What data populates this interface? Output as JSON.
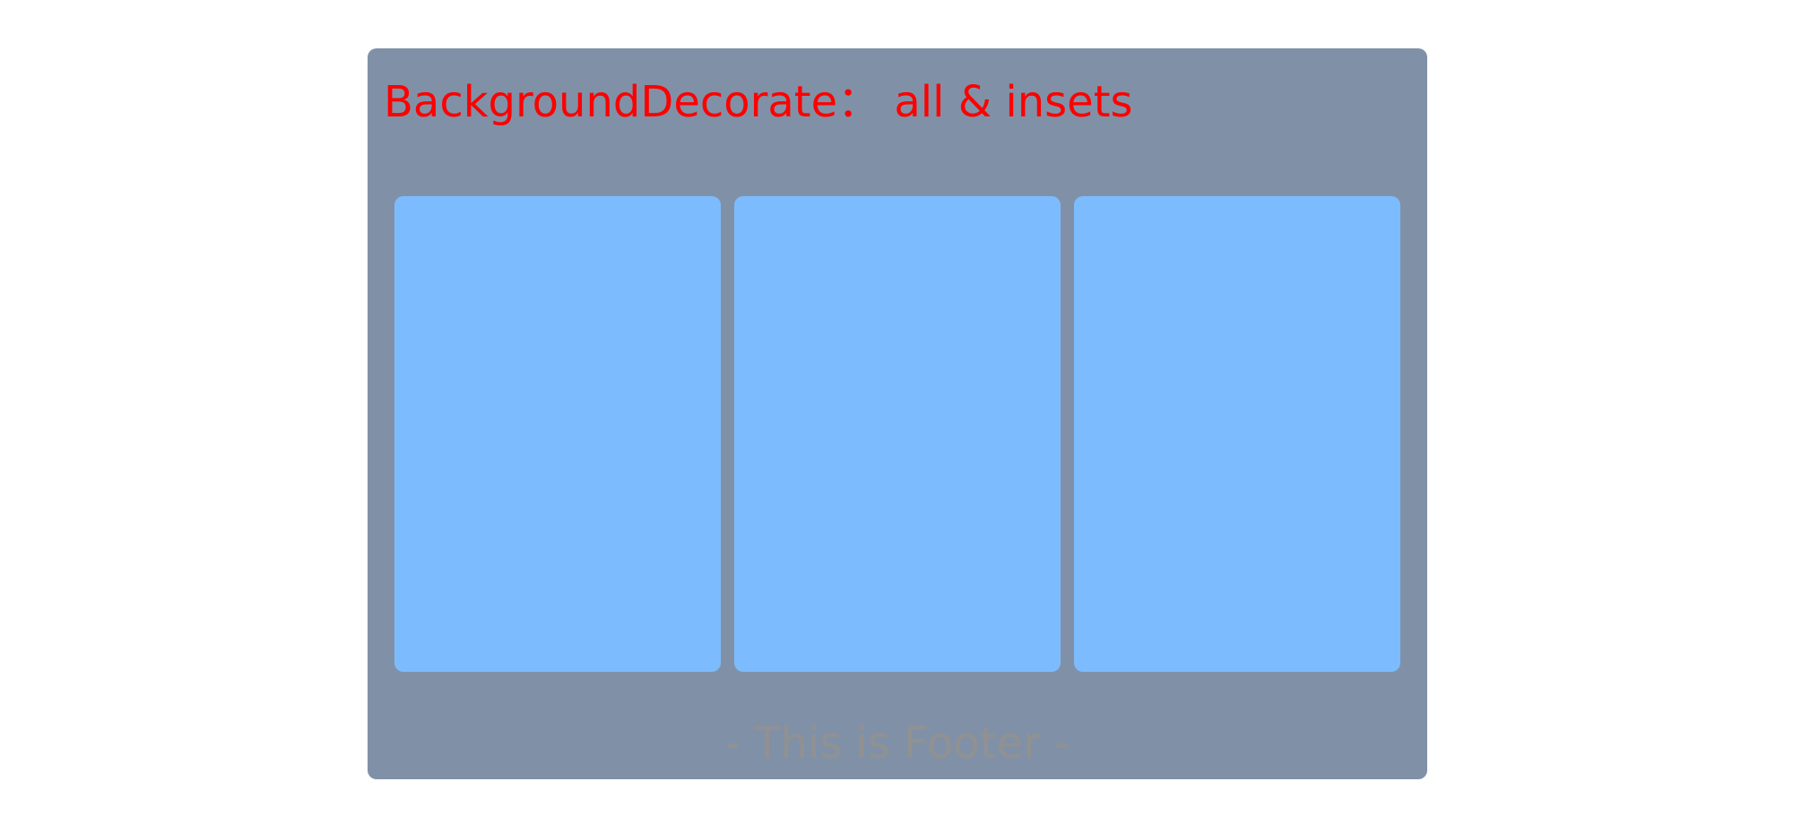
{
  "colors": {
    "page_background": "#ffffff",
    "section_background": "#8091a7",
    "item_background": "#7cbcfe",
    "header_text": "#ff0000",
    "footer_text": "#919191"
  },
  "section": {
    "header_title": "BackgroundDecorate： all & insets",
    "footer_text": "- This is Footer -",
    "items": [
      {
        "label": ""
      },
      {
        "label": ""
      },
      {
        "label": ""
      }
    ]
  }
}
